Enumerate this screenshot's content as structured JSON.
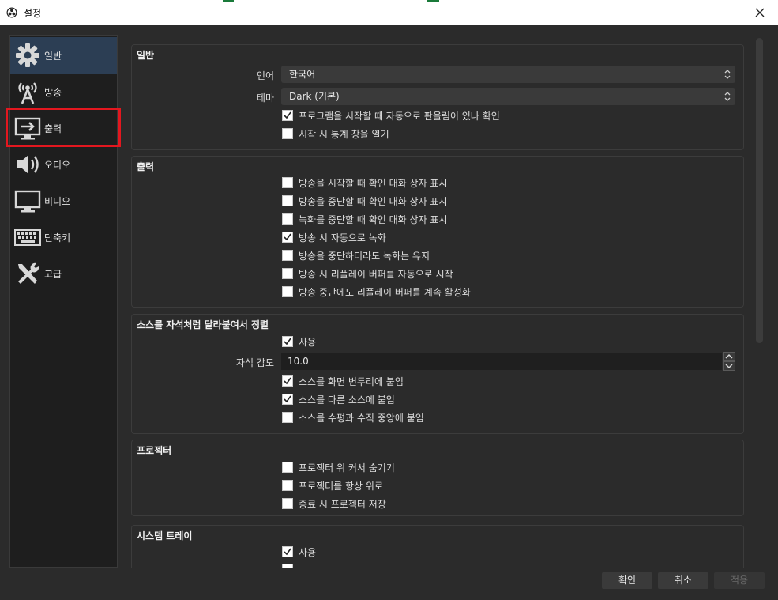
{
  "window": {
    "title": "설정"
  },
  "sidebar": {
    "items": [
      {
        "label": "일반",
        "icon": "gear-icon"
      },
      {
        "label": "방송",
        "icon": "broadcast-antenna-icon"
      },
      {
        "label": "출력",
        "icon": "output-monitor-icon"
      },
      {
        "label": "오디오",
        "icon": "speaker-icon"
      },
      {
        "label": "비디오",
        "icon": "monitor-icon"
      },
      {
        "label": "단축키",
        "icon": "keyboard-icon"
      },
      {
        "label": "고급",
        "icon": "tools-icon"
      }
    ],
    "selected": "일반",
    "highlighted": "출력"
  },
  "general": {
    "title": "일반",
    "language_label": "언어",
    "language_value": "한국어",
    "theme_label": "테마",
    "theme_value": "Dark (기본)",
    "check_updates": {
      "label": "프로그램을 시작할 때 자동으로 판올림이 있나 확인",
      "checked": true
    },
    "open_stats": {
      "label": "시작 시 통계 창을 열기",
      "checked": false
    }
  },
  "output": {
    "title": "출력",
    "items": [
      {
        "label": "방송을 시작할 때 확인 대화 상자 표시",
        "checked": false
      },
      {
        "label": "방송을 중단할 때 확인 대화 상자 표시",
        "checked": false
      },
      {
        "label": "녹화를 중단할 때 확인 대화 상자 표시",
        "checked": false
      },
      {
        "label": "방송 시 자동으로 녹화",
        "checked": true
      },
      {
        "label": "방송을 중단하더라도 녹화는 유지",
        "checked": false
      },
      {
        "label": "방송 시 리플레이 버퍼를 자동으로 시작",
        "checked": false
      },
      {
        "label": "방송 중단에도 리플레이 버퍼를 계속 활성화",
        "checked": false
      }
    ]
  },
  "snapping": {
    "title": "소스를 자석처럼 달라붙여서 정렬",
    "enable": {
      "label": "사용",
      "checked": true
    },
    "sensitivity_label": "자석 감도",
    "sensitivity_value": "10.0",
    "items": [
      {
        "label": "소스를 화면 변두리에 붙임",
        "checked": true
      },
      {
        "label": "소스를 다른 소스에 붙임",
        "checked": true
      },
      {
        "label": "소스를 수평과 수직 중앙에 붙임",
        "checked": false
      }
    ]
  },
  "projector": {
    "title": "프로젝터",
    "items": [
      {
        "label": "프로젝터 위 커서 숨기기",
        "checked": false
      },
      {
        "label": "프로젝터를 항상 위로",
        "checked": false
      },
      {
        "label": "종료 시 프로젝터 저장",
        "checked": false
      }
    ]
  },
  "tray": {
    "title": "시스템 트레이",
    "enable": {
      "label": "사용",
      "checked": true
    }
  },
  "buttons": {
    "ok": "확인",
    "cancel": "취소",
    "apply": "적용"
  },
  "colors": {
    "highlight": "#e3171f",
    "selected_bg": "#2c3e54"
  }
}
